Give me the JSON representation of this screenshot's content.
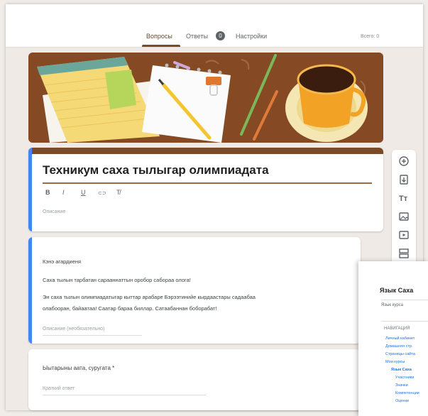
{
  "tabs": [
    {
      "label": "Вопросы",
      "active": true
    },
    {
      "label": "Ответы",
      "badge": "0"
    },
    {
      "label": "Настройки"
    }
  ],
  "total_points": "Всего: 0",
  "form": {
    "title": "Техникум саха тылыгар олимпиадата",
    "description_placeholder": "Описание"
  },
  "formatting": [
    "B",
    "I",
    "U",
    "⊂⊃",
    "T̸"
  ],
  "question1": {
    "line1": "Кэнэ агардиеня",
    "line2": "Саха тылын тарбатан сарааннаттын оробор сабораа олога!",
    "line3": "Эн саха тылын олимпиадатыгар кыттар арабаре Бэрээтинийе кырдаастары садаабаа",
    "line4": "олабооран, байаатаа! Саатар бараа биллар. Сатаабаннан боборабат!",
    "hint": "Описание (необязательно)"
  },
  "question2": {
    "text": "Ыытарыны аата, суругата *",
    "hint": "Краткий ответ"
  },
  "toolbar_icons": [
    "add-question-icon",
    "import-questions-icon",
    "add-title-icon",
    "add-image-icon",
    "add-video-icon",
    "add-section-icon"
  ],
  "popup": {
    "title": "Язык Саха",
    "tab": "Язык курса",
    "section": "НАВИГАЦИЯ",
    "rows": [
      "Личный кабинет",
      "Домашняя стр.",
      "Страницы сайта",
      "Мои курсы",
      "Язык Саха",
      "Участники",
      "Значки",
      "Компетенции",
      "Оценки"
    ]
  },
  "colors": {
    "accent_brown": "#7a4b2a",
    "accent_blue": "#4285f4",
    "page_bg": "#efeae6"
  }
}
